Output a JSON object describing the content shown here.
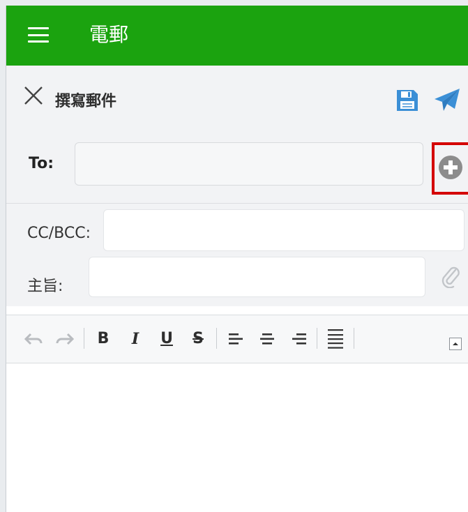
{
  "app": {
    "title": "電郵"
  },
  "compose": {
    "title": "撰寫郵件",
    "to_label": "To:",
    "to_value": "",
    "cc_label": "CC/BCC:",
    "cc_value": "",
    "subject_label": "主旨:",
    "subject_value": ""
  },
  "colors": {
    "appbar": "#1ba30f",
    "accent_blue": "#3b8fd6",
    "highlight_red": "#d40000"
  },
  "icons": {
    "menu": "hamburger-icon",
    "close": "close-icon",
    "save": "floppy-disk-icon",
    "send": "paper-plane-icon",
    "add": "plus-circle-icon",
    "attach": "paperclip-icon"
  },
  "toolbar": {
    "bold": "B",
    "italic": "I",
    "underline": "U",
    "strike": "S"
  },
  "editor": {
    "body": ""
  }
}
